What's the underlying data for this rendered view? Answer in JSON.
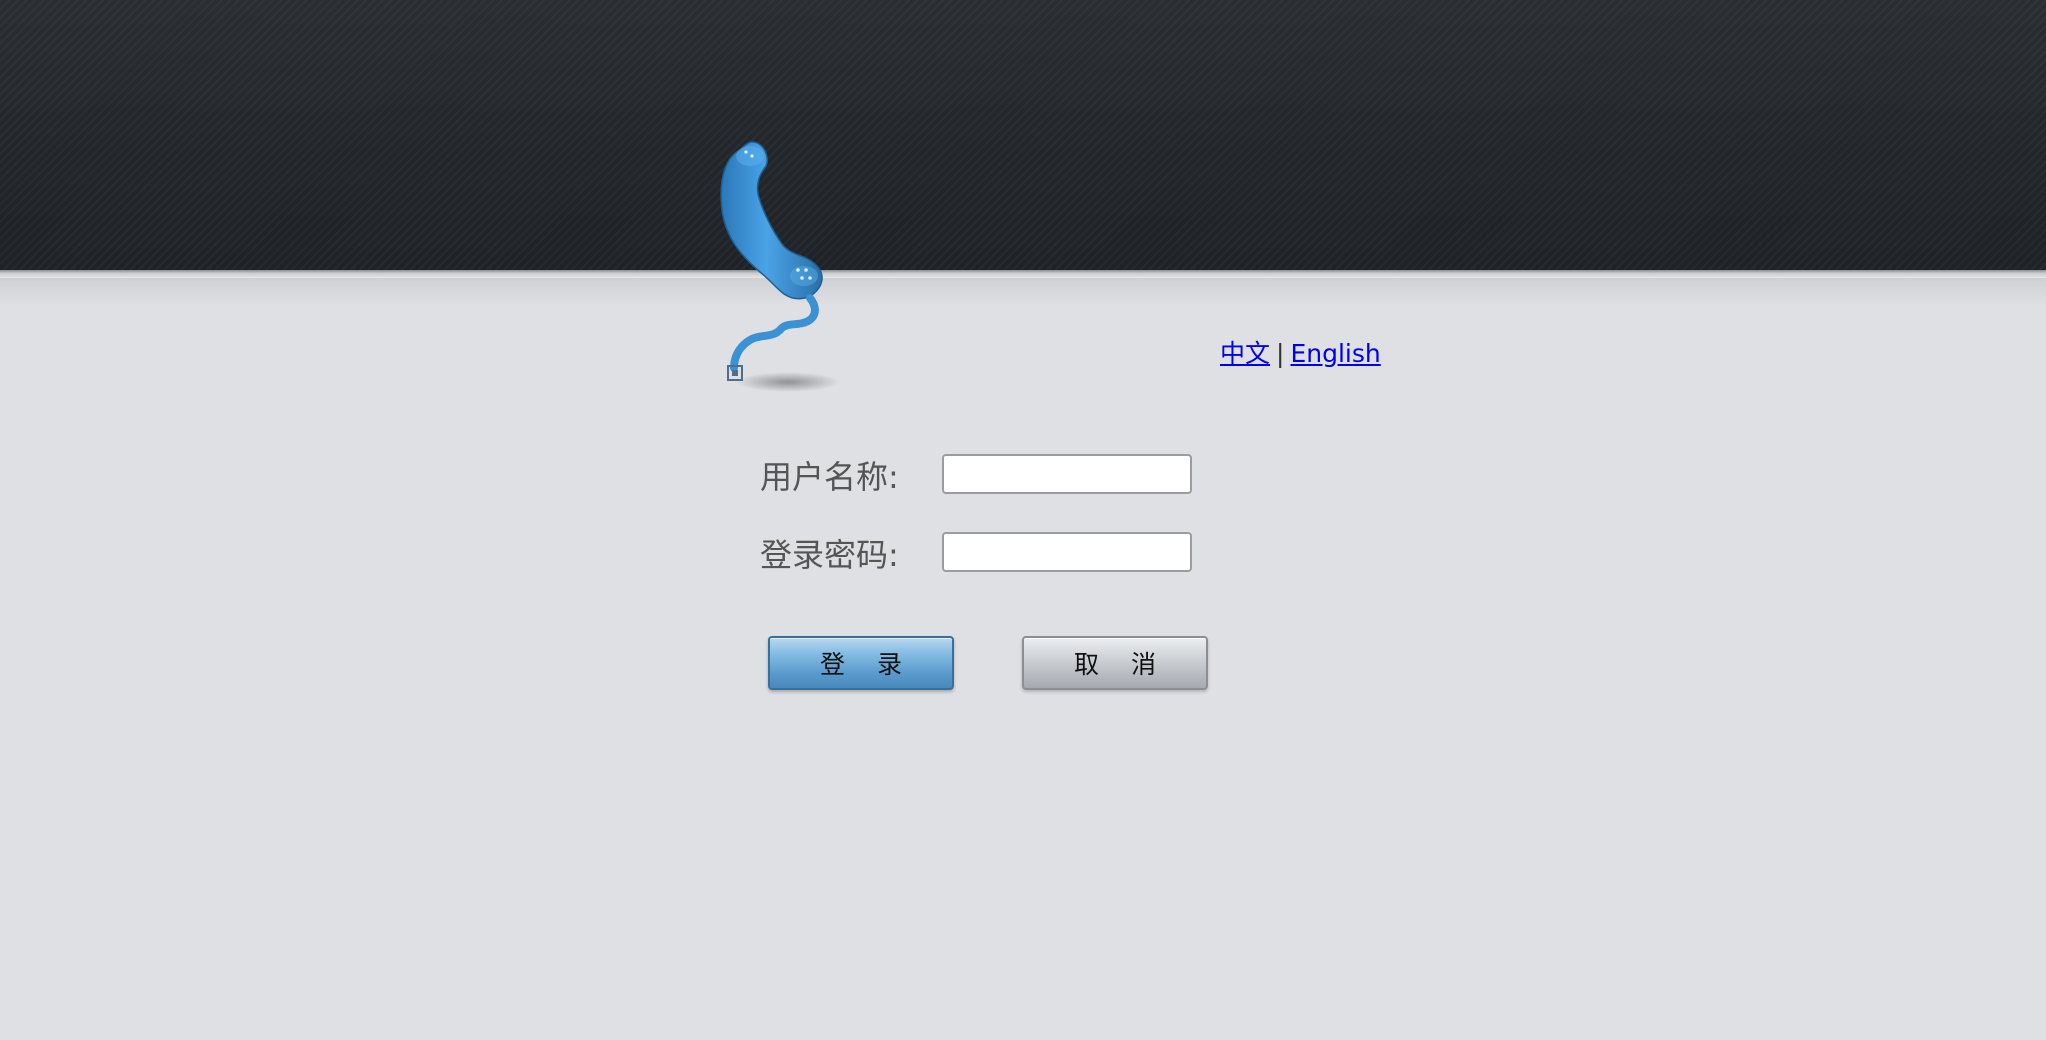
{
  "language_switch": {
    "chinese_label": "中文",
    "separator": "|",
    "english_label": "English"
  },
  "login_form": {
    "username_label": "用户名称:",
    "username_value": "",
    "password_label": "登录密码:",
    "password_value": "",
    "login_button_label": "登 录",
    "cancel_button_label": "取 消"
  },
  "colors": {
    "banner": "#23272c",
    "background": "#dfe0e4",
    "logo_blue": "#3b8fd1",
    "link": "#0000ee"
  },
  "icons": {
    "logo": "telephone-handset-icon"
  }
}
